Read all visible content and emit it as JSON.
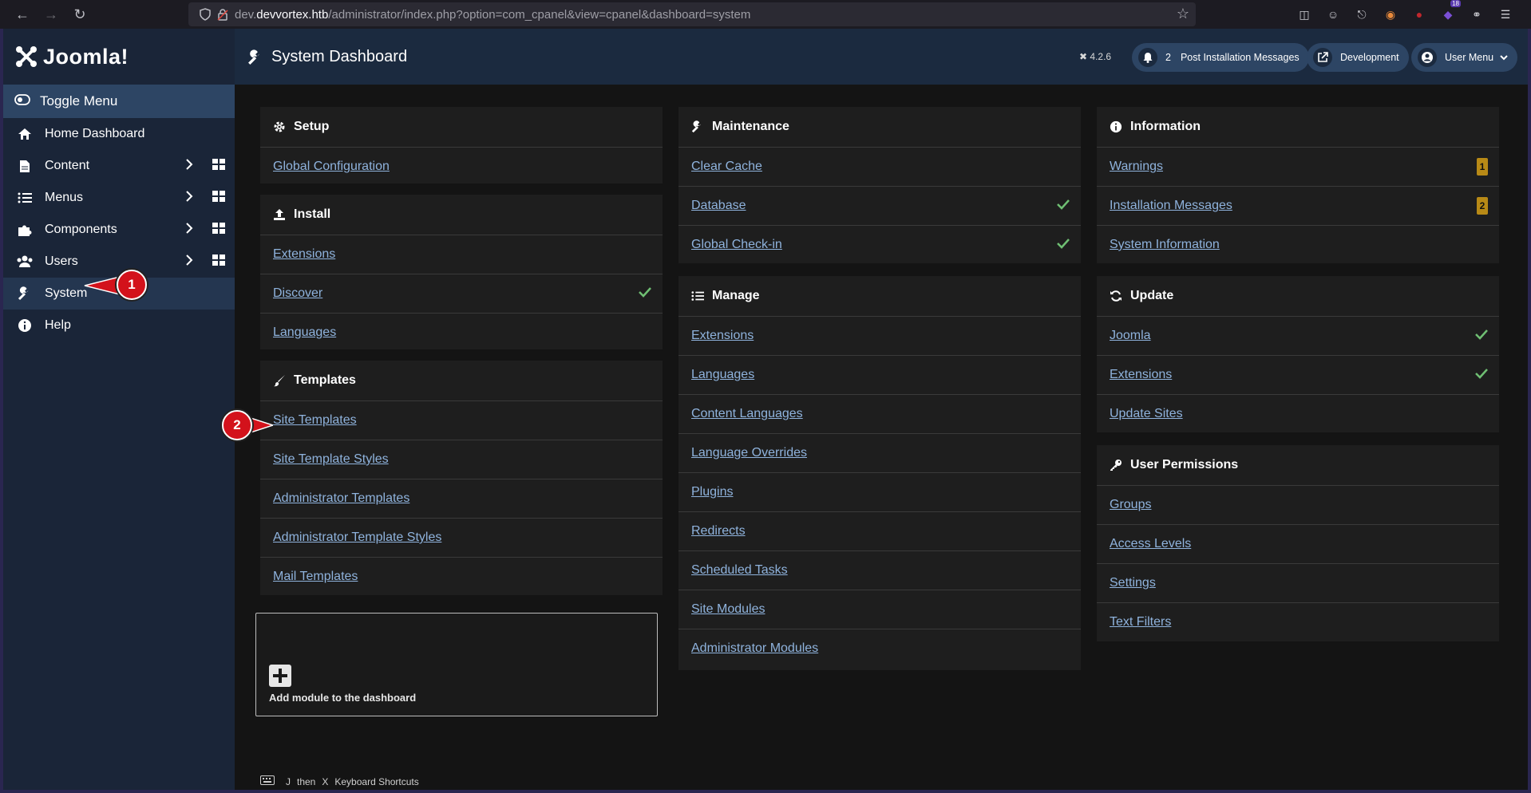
{
  "browser": {
    "url_prefix": "dev.",
    "url_domain": "devvortex.htb",
    "url_path": "/administrator/index.php?option=com_cpanel&view=cpanel&dashboard=system",
    "ext_badge": "18"
  },
  "sidebar": {
    "brand": "Joomla!",
    "toggle_label": "Toggle Menu",
    "items": [
      {
        "label": "Home Dashboard",
        "icon": "home-icon"
      },
      {
        "label": "Content",
        "icon": "file-icon"
      },
      {
        "label": "Menus",
        "icon": "list-icon"
      },
      {
        "label": "Components",
        "icon": "puzzle-icon"
      },
      {
        "label": "Users",
        "icon": "users-icon"
      },
      {
        "label": "System",
        "icon": "wrench-icon"
      },
      {
        "label": "Help",
        "icon": "info-icon"
      }
    ]
  },
  "header": {
    "title": "System Dashboard",
    "version": "4.2.6",
    "notif_count": "2",
    "post_install_label": "Post Installation Messages",
    "development_label": "Development",
    "user_menu_label": "User Menu"
  },
  "cards": {
    "setup": {
      "title": "Setup",
      "links": [
        "Global Configuration"
      ]
    },
    "install": {
      "title": "Install",
      "links": [
        "Extensions",
        "Discover",
        "Languages"
      ]
    },
    "templates": {
      "title": "Templates",
      "links": [
        "Site Templates",
        "Site Template Styles",
        "Administrator Templates",
        "Administrator Template Styles",
        "Mail Templates"
      ]
    },
    "maintenance": {
      "title": "Maintenance",
      "links": [
        "Clear Cache",
        "Database",
        "Global Check-in"
      ]
    },
    "manage": {
      "title": "Manage",
      "links": [
        "Extensions",
        "Languages",
        "Content Languages",
        "Language Overrides",
        "Plugins",
        "Redirects",
        "Scheduled Tasks",
        "Site Modules",
        "Administrator Modules"
      ]
    },
    "information": {
      "title": "Information",
      "links": [
        "Warnings",
        "Installation Messages",
        "System Information"
      ],
      "badges": [
        "1",
        "2"
      ]
    },
    "update": {
      "title": "Update",
      "links": [
        "Joomla",
        "Extensions",
        "Update Sites"
      ]
    },
    "permissions": {
      "title": "User Permissions",
      "links": [
        "Groups",
        "Access Levels",
        "Settings",
        "Text Filters"
      ]
    }
  },
  "add_module_label": "Add module to the dashboard",
  "shortcuts": {
    "key1": "J",
    "then": "then",
    "key2": "X",
    "label": "Keyboard Shortcuts"
  },
  "annotations": {
    "step1": "1",
    "step2": "2"
  },
  "colors": {
    "link": "#8fb3dd",
    "sidebar": "#1a2538",
    "header": "#1b2a3f",
    "check": "#6fbf73",
    "badge": "#b88a16",
    "annotation": "#d3121b"
  }
}
